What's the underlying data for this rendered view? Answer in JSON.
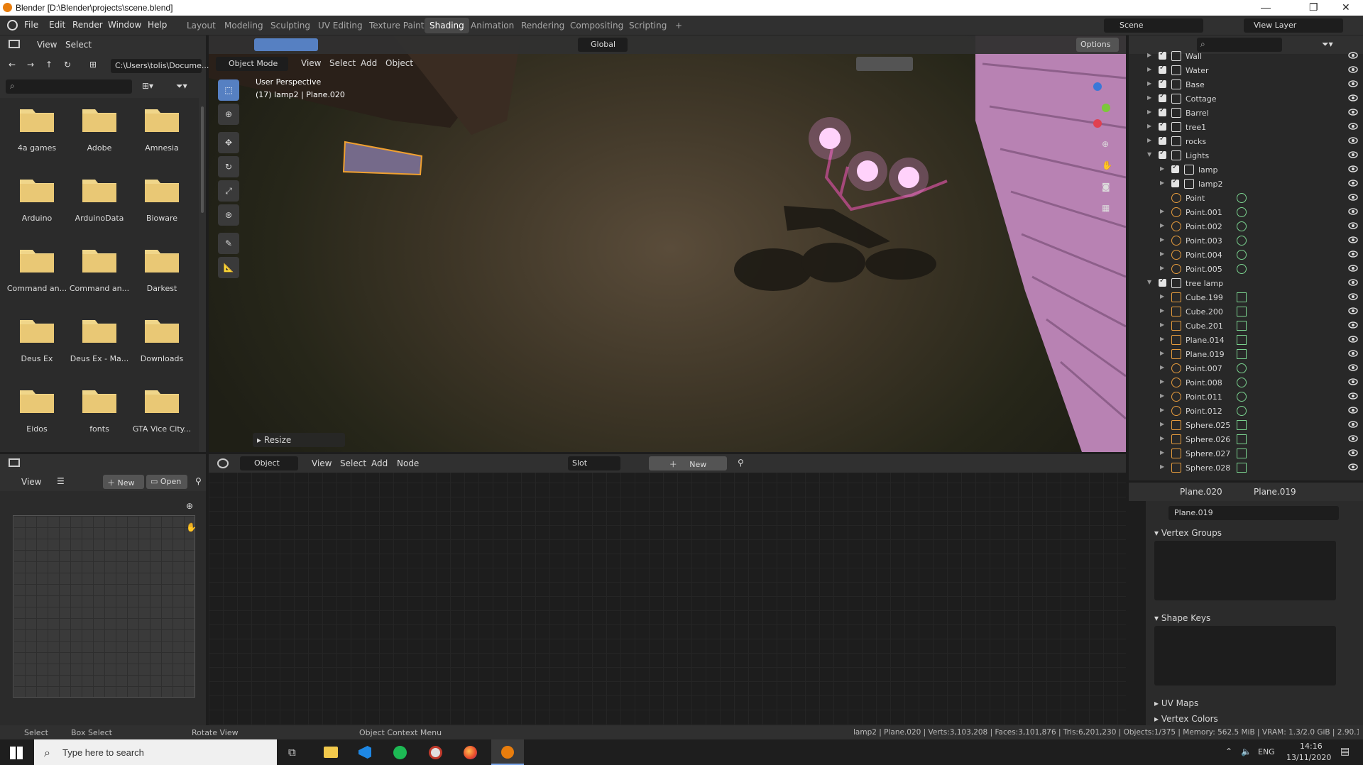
{
  "window": {
    "title": "Blender [D:\\Blender\\projects\\scene.blend]",
    "min": "—",
    "max": "❐",
    "close": "✕"
  },
  "menu": [
    "File",
    "Edit",
    "Render",
    "Window",
    "Help"
  ],
  "workspaces": [
    "Layout",
    "Modeling",
    "Sculpting",
    "UV Editing",
    "Texture Paint",
    "Shading",
    "Animation",
    "Rendering",
    "Compositing",
    "Scripting",
    "+"
  ],
  "scene": {
    "name": "Scene",
    "view_layer": "View Layer"
  },
  "filebrowser": {
    "menu": [
      "View",
      "Select"
    ],
    "path": "C:\\Users\\tolis\\Docume...",
    "folders": [
      "4a games",
      "Adobe",
      "Amnesia",
      "Arduino",
      "ArduinoData",
      "Bioware",
      "Command an...",
      "Command an...",
      "Darkest",
      "Deus Ex",
      "Deus Ex - Ma...",
      "Downloads",
      "Eidos",
      "fonts",
      "GTA Vice City..."
    ]
  },
  "viewport": {
    "mode": "Object Mode",
    "menu": [
      "View",
      "Select",
      "Add",
      "Object"
    ],
    "orientation": "Global",
    "options": "Options",
    "info1": "User Perspective",
    "info2": "(17) lamp2 | Plane.020",
    "operator": "Resize"
  },
  "imageeditor": {
    "view": "View",
    "new": "New",
    "open": "Open"
  },
  "nodeeditor": {
    "type": "Object",
    "menu": [
      "View",
      "Select",
      "Add",
      "Node"
    ],
    "slot": "Slot",
    "new": "New"
  },
  "outliner": {
    "rows": [
      {
        "name": "Wall",
        "indent": 0,
        "kind": "coll",
        "exp": "▶"
      },
      {
        "name": "Water",
        "indent": 0,
        "kind": "coll",
        "exp": "▶"
      },
      {
        "name": "Base",
        "indent": 0,
        "kind": "coll",
        "exp": "▶"
      },
      {
        "name": "Cottage",
        "indent": 0,
        "kind": "coll",
        "exp": "▶"
      },
      {
        "name": "Barrel",
        "indent": 0,
        "kind": "coll",
        "exp": "▶"
      },
      {
        "name": "tree1",
        "indent": 0,
        "kind": "coll",
        "exp": "▶"
      },
      {
        "name": "rocks",
        "indent": 0,
        "kind": "coll",
        "exp": "▶"
      },
      {
        "name": "Lights",
        "indent": 0,
        "kind": "coll",
        "exp": "▼"
      },
      {
        "name": "lamp",
        "indent": 1,
        "kind": "coll",
        "exp": "▶"
      },
      {
        "name": "lamp2",
        "indent": 1,
        "kind": "coll",
        "exp": "▶"
      },
      {
        "name": "Point",
        "indent": 1,
        "kind": "light",
        "exp": ""
      },
      {
        "name": "Point.001",
        "indent": 1,
        "kind": "light",
        "exp": "▶"
      },
      {
        "name": "Point.002",
        "indent": 1,
        "kind": "light",
        "exp": "▶"
      },
      {
        "name": "Point.003",
        "indent": 1,
        "kind": "light",
        "exp": "▶"
      },
      {
        "name": "Point.004",
        "indent": 1,
        "kind": "light",
        "exp": "▶"
      },
      {
        "name": "Point.005",
        "indent": 1,
        "kind": "light",
        "exp": "▶"
      },
      {
        "name": "tree lamp",
        "indent": 0,
        "kind": "coll",
        "exp": "▼"
      },
      {
        "name": "Cube.199",
        "indent": 1,
        "kind": "mesh",
        "exp": "▶"
      },
      {
        "name": "Cube.200",
        "indent": 1,
        "kind": "mesh",
        "exp": "▶"
      },
      {
        "name": "Cube.201",
        "indent": 1,
        "kind": "mesh",
        "exp": "▶"
      },
      {
        "name": "Plane.014",
        "indent": 1,
        "kind": "mesh",
        "exp": "▶"
      },
      {
        "name": "Plane.019",
        "indent": 1,
        "kind": "mesh",
        "exp": "▶"
      },
      {
        "name": "Point.007",
        "indent": 1,
        "kind": "light",
        "exp": "▶"
      },
      {
        "name": "Point.008",
        "indent": 1,
        "kind": "light",
        "exp": "▶"
      },
      {
        "name": "Point.011",
        "indent": 1,
        "kind": "light",
        "exp": "▶"
      },
      {
        "name": "Point.012",
        "indent": 1,
        "kind": "light",
        "exp": "▶"
      },
      {
        "name": "Sphere.025",
        "indent": 1,
        "kind": "mesh",
        "exp": "▶"
      },
      {
        "name": "Sphere.026",
        "indent": 1,
        "kind": "mesh",
        "exp": "▶"
      },
      {
        "name": "Sphere.027",
        "indent": 1,
        "kind": "mesh",
        "exp": "▶"
      },
      {
        "name": "Sphere.028",
        "indent": 1,
        "kind": "mesh",
        "exp": "▶"
      }
    ]
  },
  "properties": {
    "object": "Plane.020",
    "data": "Plane.019",
    "mesh": "Plane.019",
    "sections": [
      "Vertex Groups",
      "Shape Keys",
      "UV Maps",
      "Vertex Colors"
    ]
  },
  "statusbar": {
    "select": "Select",
    "box": "Box Select",
    "rotate": "Rotate View",
    "context": "Object Context Menu",
    "stats": "lamp2 | Plane.020 | Verts:3,103,208 | Faces:3,101,876 | Tris:6,201,230 | Objects:1/375 | Memory: 562.5 MiB | VRAM: 1.3/2.0 GiB | 2.90.1"
  },
  "taskbar": {
    "search": "Type here to search",
    "lang": "ENG",
    "time": "14:16",
    "date": "13/11/2020"
  },
  "colors": {
    "accent": "#5680c2",
    "orange": "#e59b3d",
    "green": "#7ad28f",
    "lightglow": "#ff9cf4"
  }
}
